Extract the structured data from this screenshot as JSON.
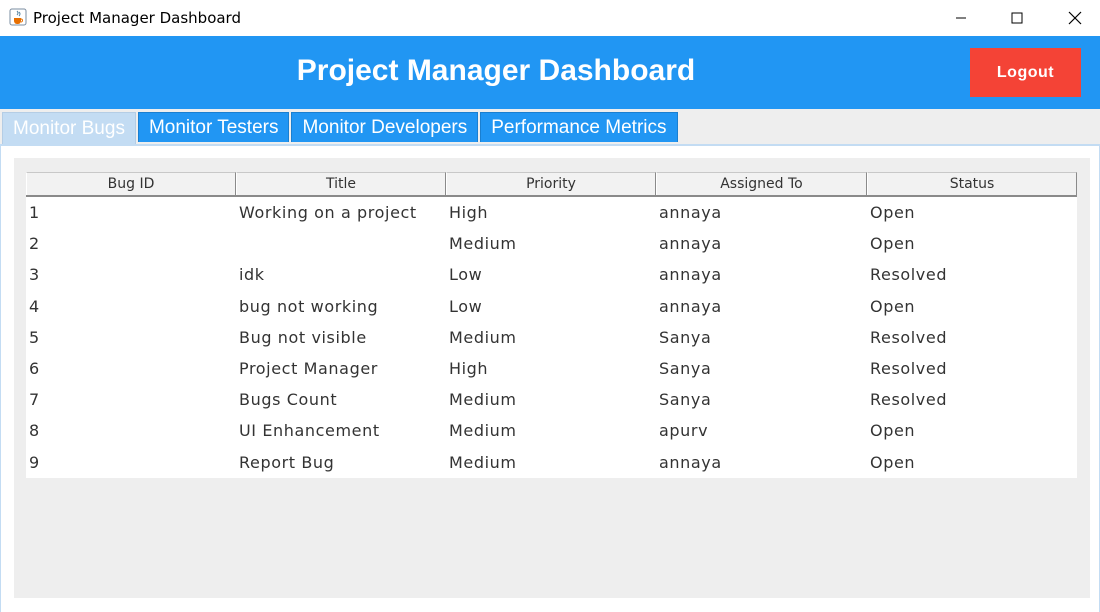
{
  "window": {
    "title": "Project Manager Dashboard"
  },
  "header": {
    "title": "Project Manager Dashboard",
    "logout_label": "Logout"
  },
  "tabs": [
    {
      "label": "Monitor Bugs",
      "active": true
    },
    {
      "label": "Monitor Testers",
      "active": false
    },
    {
      "label": "Monitor Developers",
      "active": false
    },
    {
      "label": "Performance Metrics",
      "active": false
    }
  ],
  "table": {
    "columns": [
      "Bug ID",
      "Title",
      "Priority",
      "Assigned To",
      "Status"
    ],
    "rows": [
      [
        "1",
        "Working on a project",
        "High",
        "annaya",
        "Open"
      ],
      [
        "2",
        "",
        "Medium",
        "annaya",
        "Open"
      ],
      [
        "3",
        "idk",
        "Low",
        "annaya",
        "Resolved"
      ],
      [
        "4",
        "bug not working",
        "Low",
        "annaya",
        "Open"
      ],
      [
        "5",
        "Bug not visible",
        "Medium",
        "Sanya",
        "Resolved"
      ],
      [
        "6",
        "Project Manager",
        "High",
        "Sanya",
        "Resolved"
      ],
      [
        "7",
        "Bugs Count",
        "Medium",
        "Sanya",
        "Resolved"
      ],
      [
        "8",
        "UI Enhancement",
        "Medium",
        "apurv",
        "Open"
      ],
      [
        "9",
        "Report Bug",
        "Medium",
        "annaya",
        "Open"
      ]
    ]
  },
  "colors": {
    "header_bg": "#2196f3",
    "logout_bg": "#f44336",
    "tab_bg": "#2196f3",
    "active_tab_bg": "#c3dcf3",
    "panel_bg": "#eeeeee"
  },
  "icons": {
    "app": "java-cup-icon",
    "minimize": "minimize-icon",
    "maximize": "maximize-icon",
    "close": "close-icon"
  }
}
